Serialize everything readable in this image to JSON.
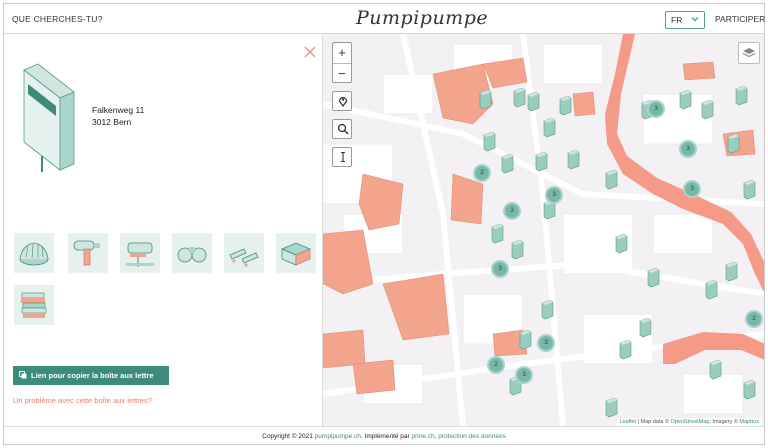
{
  "header": {
    "search_label": "QUE CHERCHES-TU?",
    "logo": "Pumpipumpe",
    "language": "FR",
    "participate_label": "PARTICIPER"
  },
  "panel": {
    "address_line1": "Falkenweg 11",
    "address_line2": "3012 Bern",
    "stickers": [
      "bundt-cake-pan-icon",
      "hair-dryer-icon",
      "jigsaw-icon",
      "binoculars-icon",
      "skates-icon",
      "crate-icon",
      "books-icon"
    ],
    "copy_button": "Lien pour copier la boîte aux lettre",
    "report_link": "Un problème avec cette boîte aux lettres?"
  },
  "map": {
    "zoom_in": "+",
    "zoom_out": "−",
    "clusters": [
      "2",
      "3",
      "3",
      "3",
      "3",
      "3",
      "2",
      "3",
      "2",
      "3",
      "3"
    ],
    "attribution": {
      "leaflet": "Leaflet",
      "text1": " | Map data © ",
      "osm": "OpenStreetMap",
      "text2": ", Imagery © ",
      "mapbox": "Mapbox"
    }
  },
  "footer": {
    "copyright": "Copyright © 2021 ",
    "site": "pumpipumpe.ch",
    "implemented": ". Implémenté par ",
    "prine": "prine.ch",
    "sep": ", ",
    "privacy": "protection des données"
  },
  "colors": {
    "accent": "#3d8c7b",
    "marker": "#78b8ab",
    "building": "#f2a48d",
    "river": "#f49a86",
    "link_warning": "#e8826a"
  }
}
